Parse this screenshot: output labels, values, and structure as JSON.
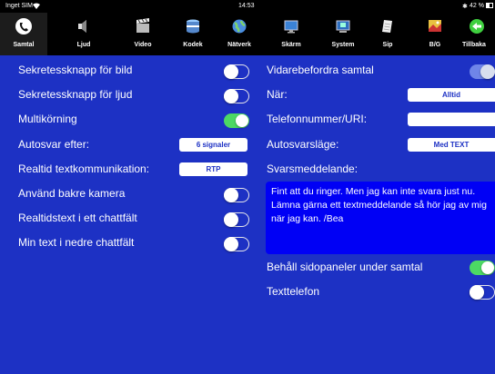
{
  "status": {
    "carrier": "Inget SIM",
    "time": "14:53",
    "battery": "42 %"
  },
  "toolbar": [
    {
      "label": "Samtal"
    },
    {
      "label": "Ljud"
    },
    {
      "label": "Video"
    },
    {
      "label": "Kodek"
    },
    {
      "label": "Nätverk"
    },
    {
      "label": "Skärm"
    },
    {
      "label": "System"
    },
    {
      "label": "Sip"
    },
    {
      "label": "B/G"
    },
    {
      "label": "Tillbaka"
    }
  ],
  "left": {
    "privacy_video": "Sekretessknapp för bild",
    "privacy_audio": "Sekretessknapp för ljud",
    "multitasking": "Multikörning",
    "autoanswer": "Autosvar efter:",
    "autoanswer_value": "6 signaler",
    "realtime_text": "Realtid textkommunikation:",
    "realtime_text_value": "RTP",
    "rear_camera": "Använd bakre kamera",
    "rtt_one_field": "Realtidstext i ett chattfält",
    "my_text_lower": "Min text i nedre chattfält"
  },
  "right": {
    "forward_call": "Vidarebefordra samtal",
    "when": "När:",
    "when_value": "Alltid",
    "phone_uri": "Telefonnummer/URI:",
    "phone_uri_value": "",
    "autoanswer_mode": "Autosvarsläge:",
    "autoanswer_mode_value": "Med TEXT",
    "answer_message": "Svarsmeddelande:",
    "answer_message_text": "Fint att du ringer. Men jag kan inte svara just nu. Lämna gärna ett textmeddelande så hör jag av mig när jag kan. /Bea",
    "keep_side_panels": "Behåll sidopaneler under samtal",
    "text_telephone": "Texttelefon"
  },
  "colors": {
    "background": "#1d31c4",
    "toggle_on": "#4cd964",
    "message_box": "#0000f5"
  }
}
